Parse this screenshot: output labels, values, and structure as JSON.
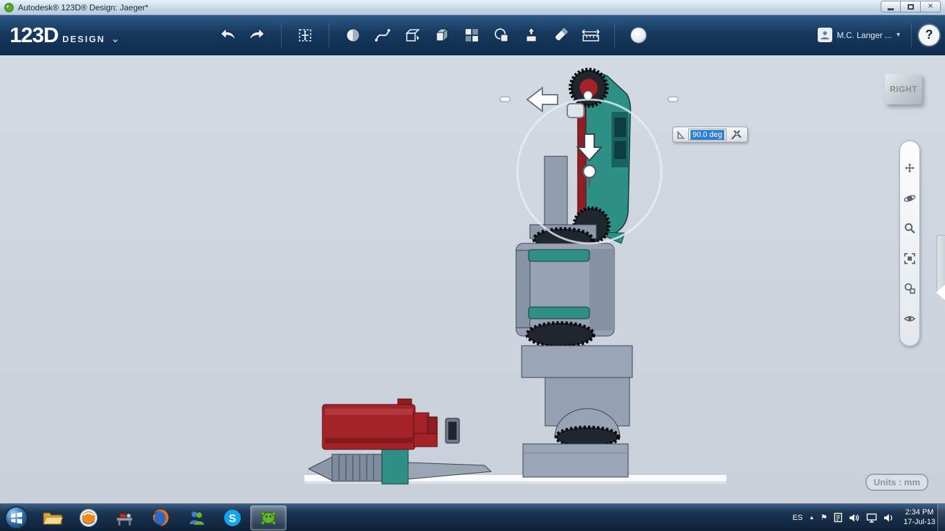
{
  "window": {
    "title": "Autodesk® 123D® Design: Jaeger*",
    "close_glyph": "✕"
  },
  "header": {
    "logo_main": "123D",
    "logo_sub": "DESIGN",
    "account_name": "M.C. Langer  ...",
    "help_label": "?"
  },
  "icons": {
    "chevron_down": "⌄",
    "chevron_small": "▾",
    "chevron_up": "▲",
    "flag": "⚑",
    "skype": "S"
  },
  "viewport": {
    "view_cube_label": "RIGHT",
    "angle_value": "90.0 deg",
    "units_label": "Units : mm"
  },
  "taskbar": {
    "tray_language": "ES",
    "clock_time": "2:34 PM",
    "clock_date": "17-Jul-13"
  }
}
